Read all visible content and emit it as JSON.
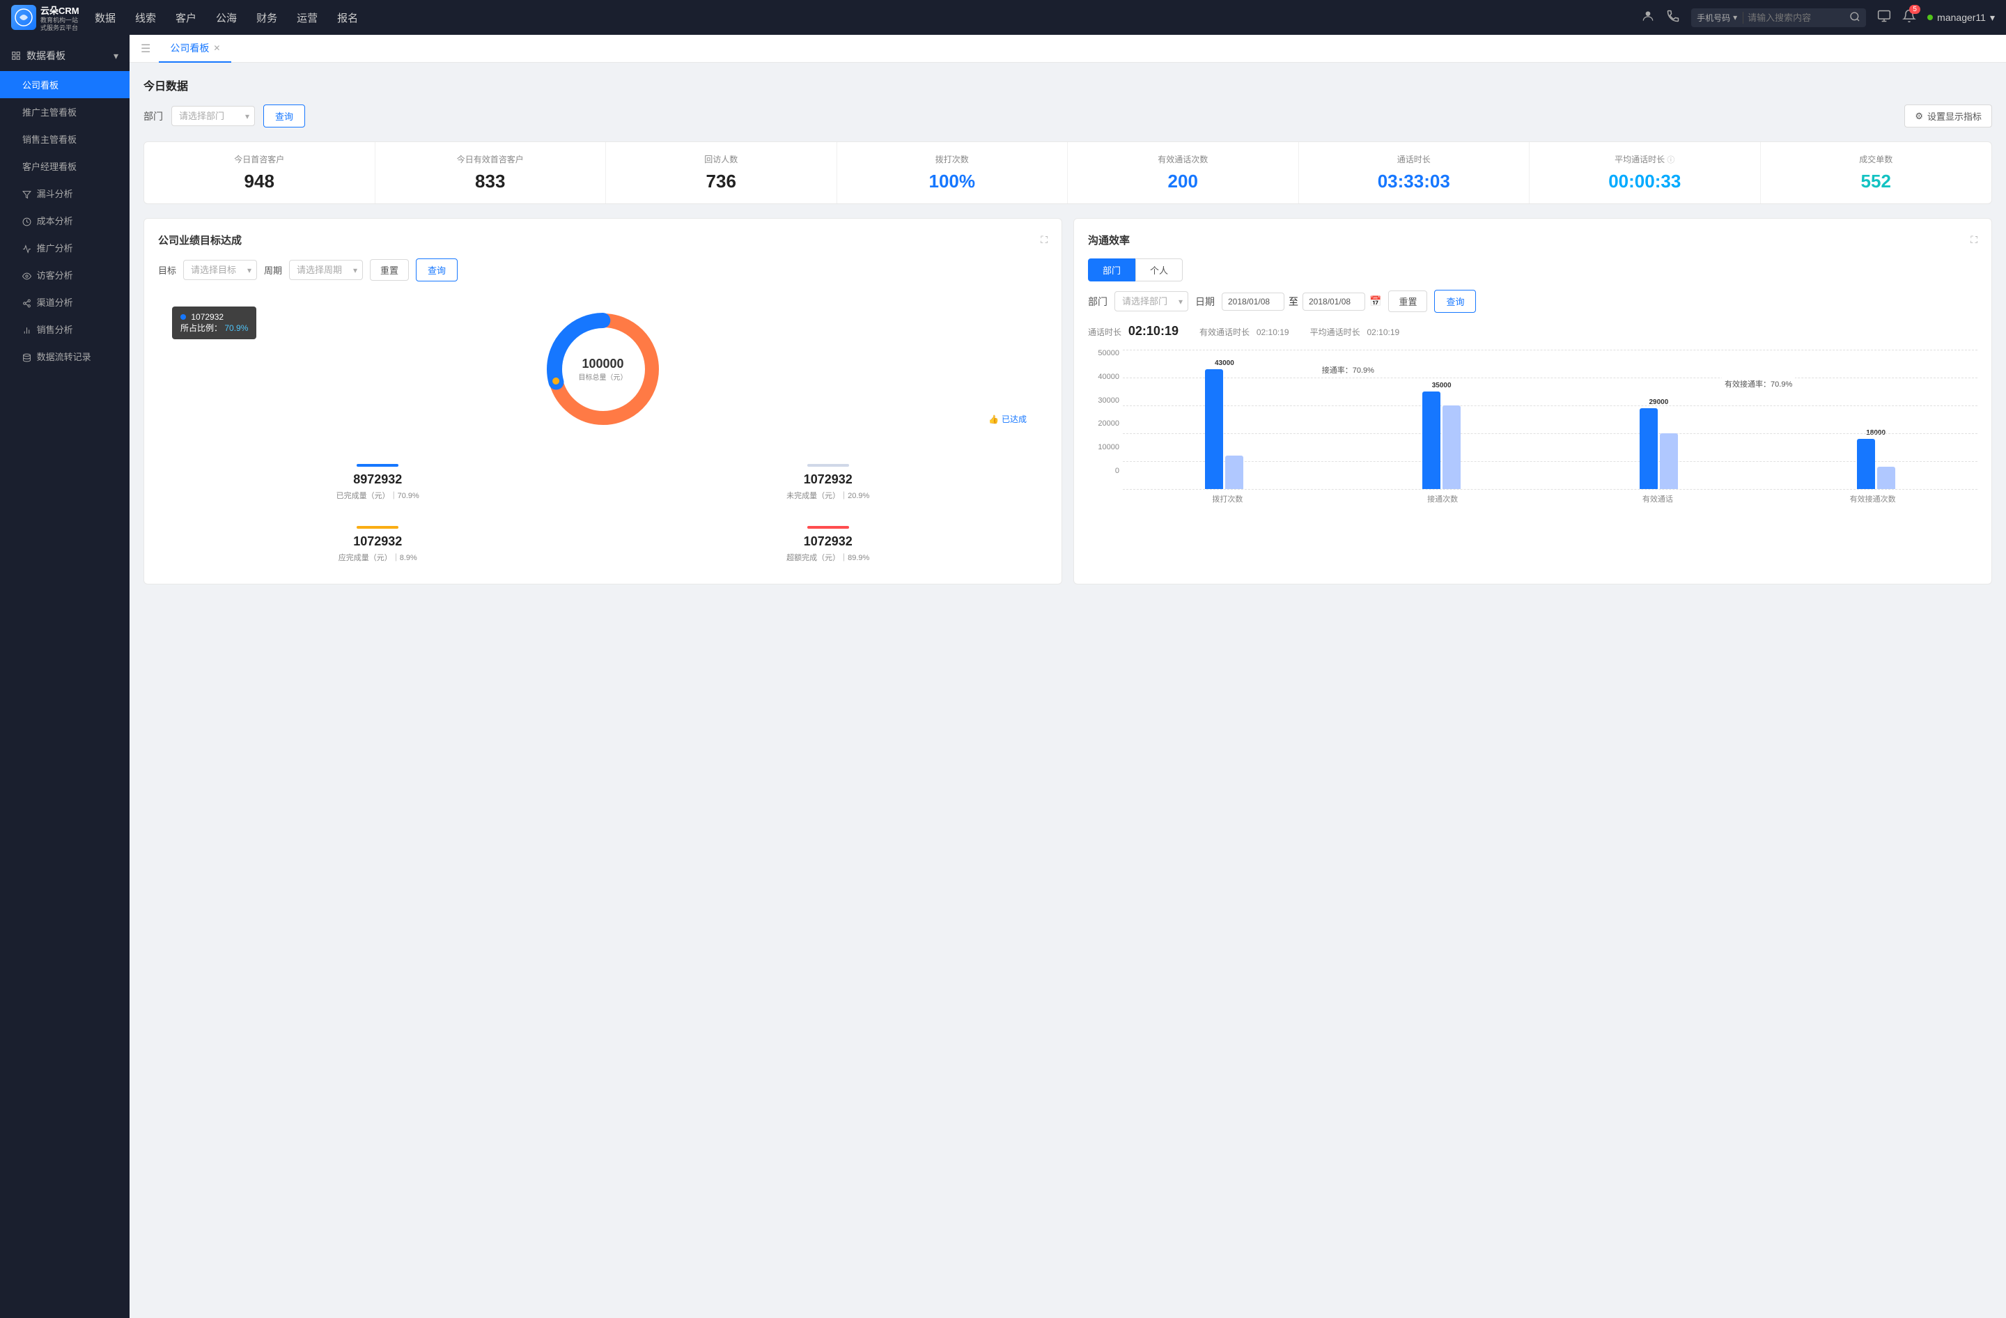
{
  "app": {
    "logo_text": "云朵CRM",
    "logo_sub": "教育机构一站\n注服务云平台"
  },
  "nav": {
    "items": [
      "数据",
      "线索",
      "客户",
      "公海",
      "财务",
      "运营",
      "报名"
    ],
    "search_placeholder": "请输入搜索内容",
    "search_type": "手机号码",
    "notification_count": "5",
    "user_name": "manager11"
  },
  "sidebar": {
    "section_label": "数据看板",
    "items": [
      {
        "label": "公司看板",
        "active": true
      },
      {
        "label": "推广主管看板",
        "active": false
      },
      {
        "label": "销售主管看板",
        "active": false
      },
      {
        "label": "客户经理看板",
        "active": false
      },
      {
        "label": "漏斗分析",
        "active": false
      },
      {
        "label": "成本分析",
        "active": false
      },
      {
        "label": "推广分析",
        "active": false
      },
      {
        "label": "访客分析",
        "active": false
      },
      {
        "label": "渠道分析",
        "active": false
      },
      {
        "label": "销售分析",
        "active": false
      },
      {
        "label": "数据流转记录",
        "active": false
      }
    ]
  },
  "tabs": [
    {
      "label": "公司看板",
      "active": true
    }
  ],
  "today_section": {
    "title": "今日数据",
    "filter_label": "部门",
    "filter_placeholder": "请选择部门",
    "query_btn": "查询",
    "settings_btn": "设置显示指标"
  },
  "stats": [
    {
      "label": "今日首咨客户",
      "value": "948",
      "color": "dark"
    },
    {
      "label": "今日有效首咨客户",
      "value": "833",
      "color": "dark"
    },
    {
      "label": "回访人数",
      "value": "736",
      "color": "dark"
    },
    {
      "label": "拨打次数",
      "value": "100%",
      "color": "blue"
    },
    {
      "label": "有效通话次数",
      "value": "200",
      "color": "blue"
    },
    {
      "label": "通话时长",
      "value": "03:33:03",
      "color": "blue"
    },
    {
      "label": "平均通话时长",
      "value": "00:00:33",
      "color": "cyan"
    },
    {
      "label": "成交单数",
      "value": "552",
      "color": "teal"
    }
  ],
  "goal_panel": {
    "title": "公司业绩目标达成",
    "goal_label": "目标",
    "goal_placeholder": "请选择目标",
    "period_label": "周期",
    "period_placeholder": "请选择周期",
    "reset_btn": "重置",
    "query_btn": "查询",
    "tooltip": {
      "value": "1072932",
      "pct_label": "所占比例：",
      "pct_value": "70.9%"
    },
    "donut": {
      "center_value": "100000",
      "center_sub": "目标总量（元）",
      "achieved_label": "已达成",
      "achieved_pct": 70.9,
      "total_arc": 360
    },
    "stats": [
      {
        "color": "#1677ff",
        "value": "8972932",
        "desc": "已完成量（元）｜70.9%"
      },
      {
        "color": "#d0d8e8",
        "value": "1072932",
        "desc": "未完成量（元）｜20.9%"
      },
      {
        "color": "#faad14",
        "value": "1072932",
        "desc": "应完成量（元）｜8.9%"
      },
      {
        "color": "#ff4d4f",
        "value": "1072932",
        "desc": "超额完成（元）｜89.9%"
      }
    ]
  },
  "comm_panel": {
    "title": "沟通效率",
    "tab_dept": "部门",
    "tab_personal": "个人",
    "active_tab": "dept",
    "dept_label": "部门",
    "dept_placeholder": "请选择部门",
    "date_label": "日期",
    "date_from": "2018/01/08",
    "date_to": "2018/01/08",
    "reset_btn": "重置",
    "query_btn": "查询",
    "call_duration_label": "通话时长",
    "call_duration_val": "02:10:19",
    "effective_call_label": "有效通话时长",
    "effective_call_val": "02:10:19",
    "avg_call_label": "平均通话时长",
    "avg_call_val": "02:10:19",
    "chart": {
      "y_ticks": [
        "50000",
        "40000",
        "30000",
        "20000",
        "10000",
        "0"
      ],
      "groups": [
        {
          "label": "拨打次数",
          "bars": [
            {
              "value": 43000,
              "label": "43000",
              "type": "blue"
            },
            {
              "value": 12000,
              "label": "",
              "type": "light"
            }
          ]
        },
        {
          "label": "接通次数",
          "bars": [
            {
              "value": 35000,
              "label": "35000",
              "type": "blue"
            },
            {
              "value": 30000,
              "label": "",
              "type": "light"
            }
          ],
          "rate_label": "接通率：70.9%",
          "rate_pos": "mid"
        },
        {
          "label": "有效通话",
          "bars": [
            {
              "value": 29000,
              "label": "29000",
              "type": "blue"
            },
            {
              "value": 20000,
              "label": "",
              "type": "light"
            }
          ],
          "rate_label": "有效接通率：70.9%",
          "rate_pos": "mid"
        },
        {
          "label": "有效接通次数",
          "bars": [
            {
              "value": 18000,
              "label": "18000",
              "type": "blue"
            },
            {
              "value": 8000,
              "label": "",
              "type": "light"
            }
          ]
        }
      ],
      "max_value": 50000
    }
  }
}
